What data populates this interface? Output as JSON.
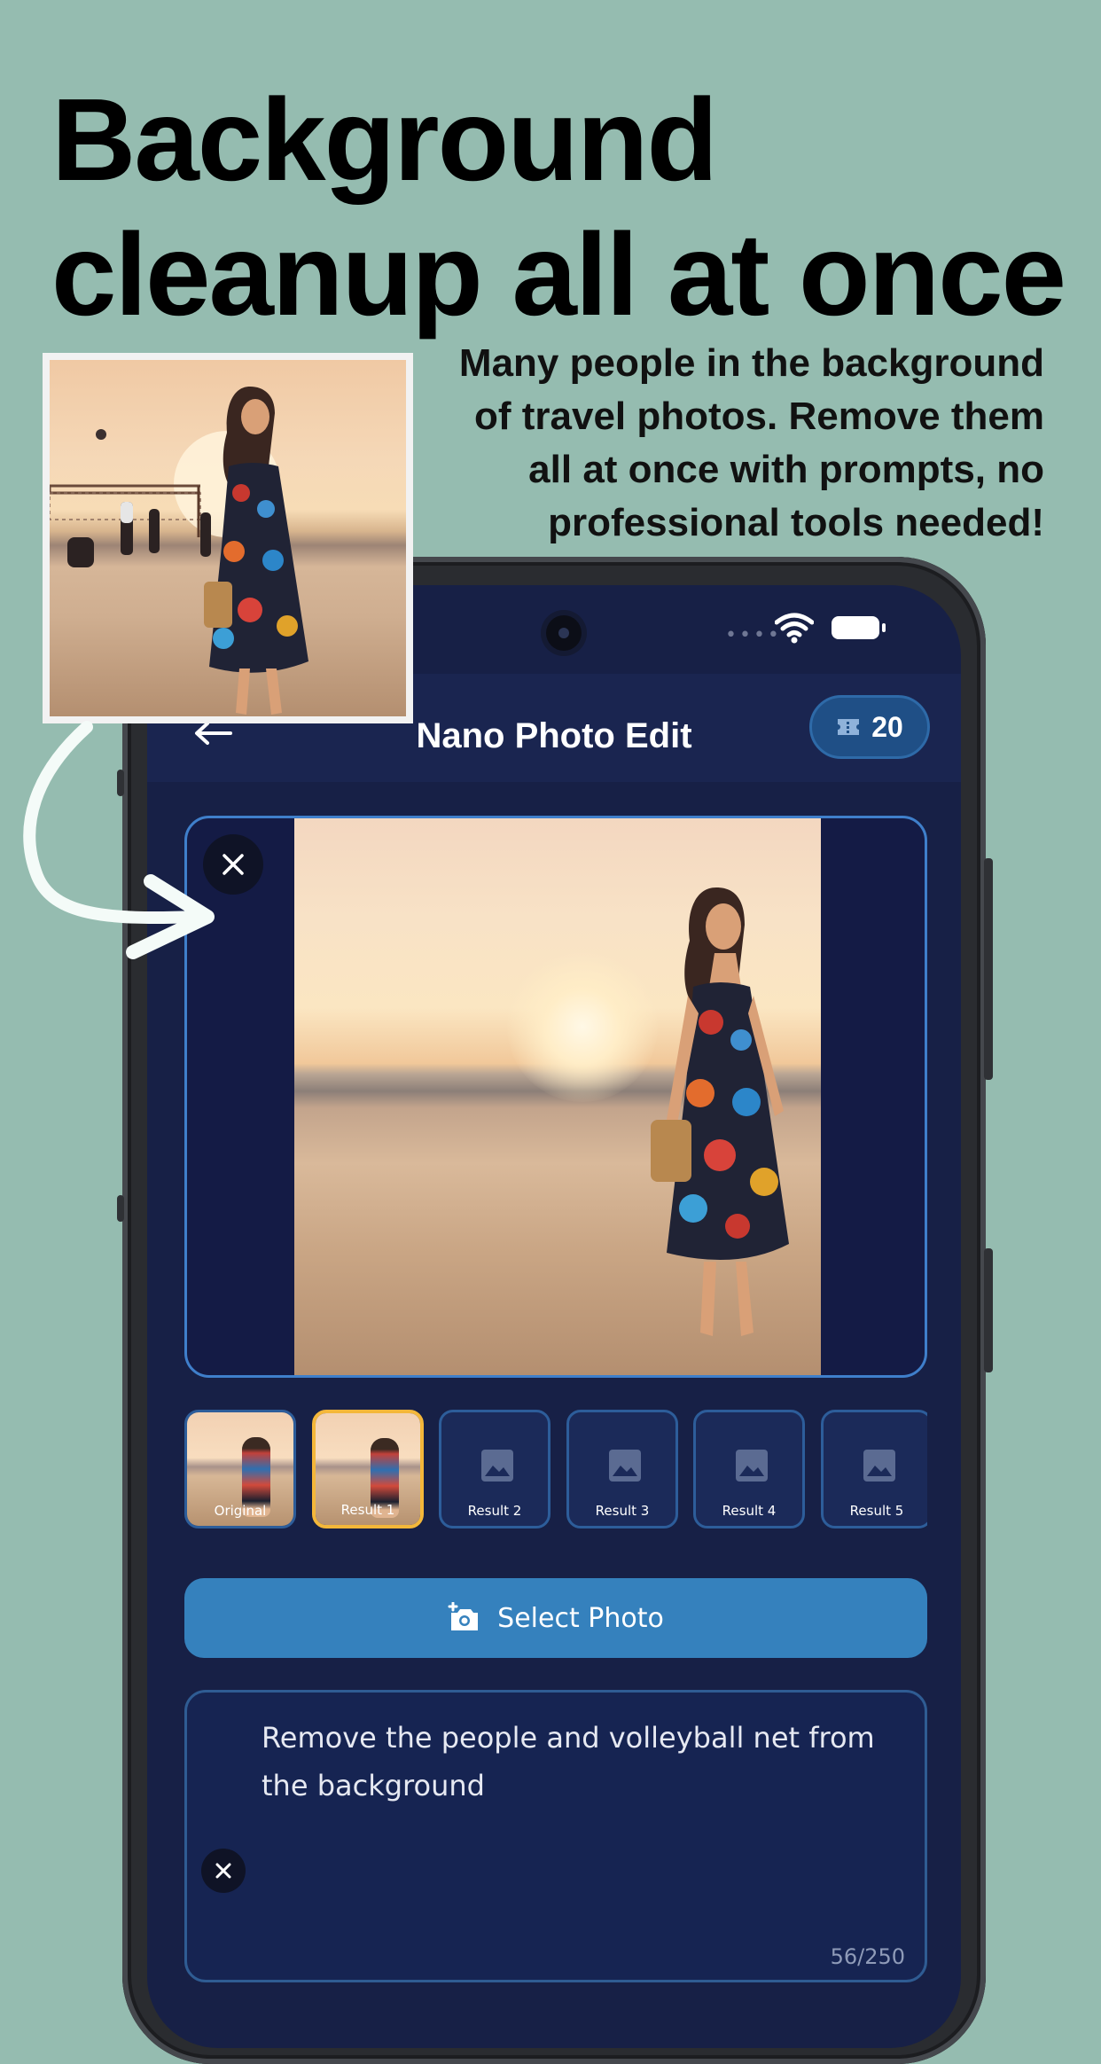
{
  "headline": {
    "line1": "Background",
    "line2": "cleanup all at once"
  },
  "subhead": {
    "lines": [
      "Many people in the background",
      "of travel photos. Remove them",
      "all at once with prompts, no",
      "professional tools needed!"
    ]
  },
  "app": {
    "title": "Nano Photo Edit",
    "credits": "20",
    "thumbnails": [
      {
        "label": "Original",
        "selected": false,
        "has_image": true
      },
      {
        "label": "Result 1",
        "selected": true,
        "has_image": true
      },
      {
        "label": "Result 2",
        "selected": false,
        "has_image": false
      },
      {
        "label": "Result 3",
        "selected": false,
        "has_image": false
      },
      {
        "label": "Result 4",
        "selected": false,
        "has_image": false
      },
      {
        "label": "Result 5",
        "selected": false,
        "has_image": false
      }
    ],
    "select_photo_label": "Select Photo",
    "prompt": {
      "value": "Remove the people and volleyball net from the background",
      "counter": "56/250"
    }
  },
  "colors": {
    "page_background": "#95bcb0",
    "screen_background": "#172046",
    "accent_blue": "#3581bd",
    "selected_border": "#f4b73a"
  },
  "icons": {
    "back": "arrow-left-icon",
    "credits": "ticket-icon",
    "close": "close-icon",
    "select_photo": "add-photo-camera-icon",
    "placeholder": "image-placeholder-icon",
    "wifi": "wifi-icon",
    "battery": "battery-icon"
  }
}
